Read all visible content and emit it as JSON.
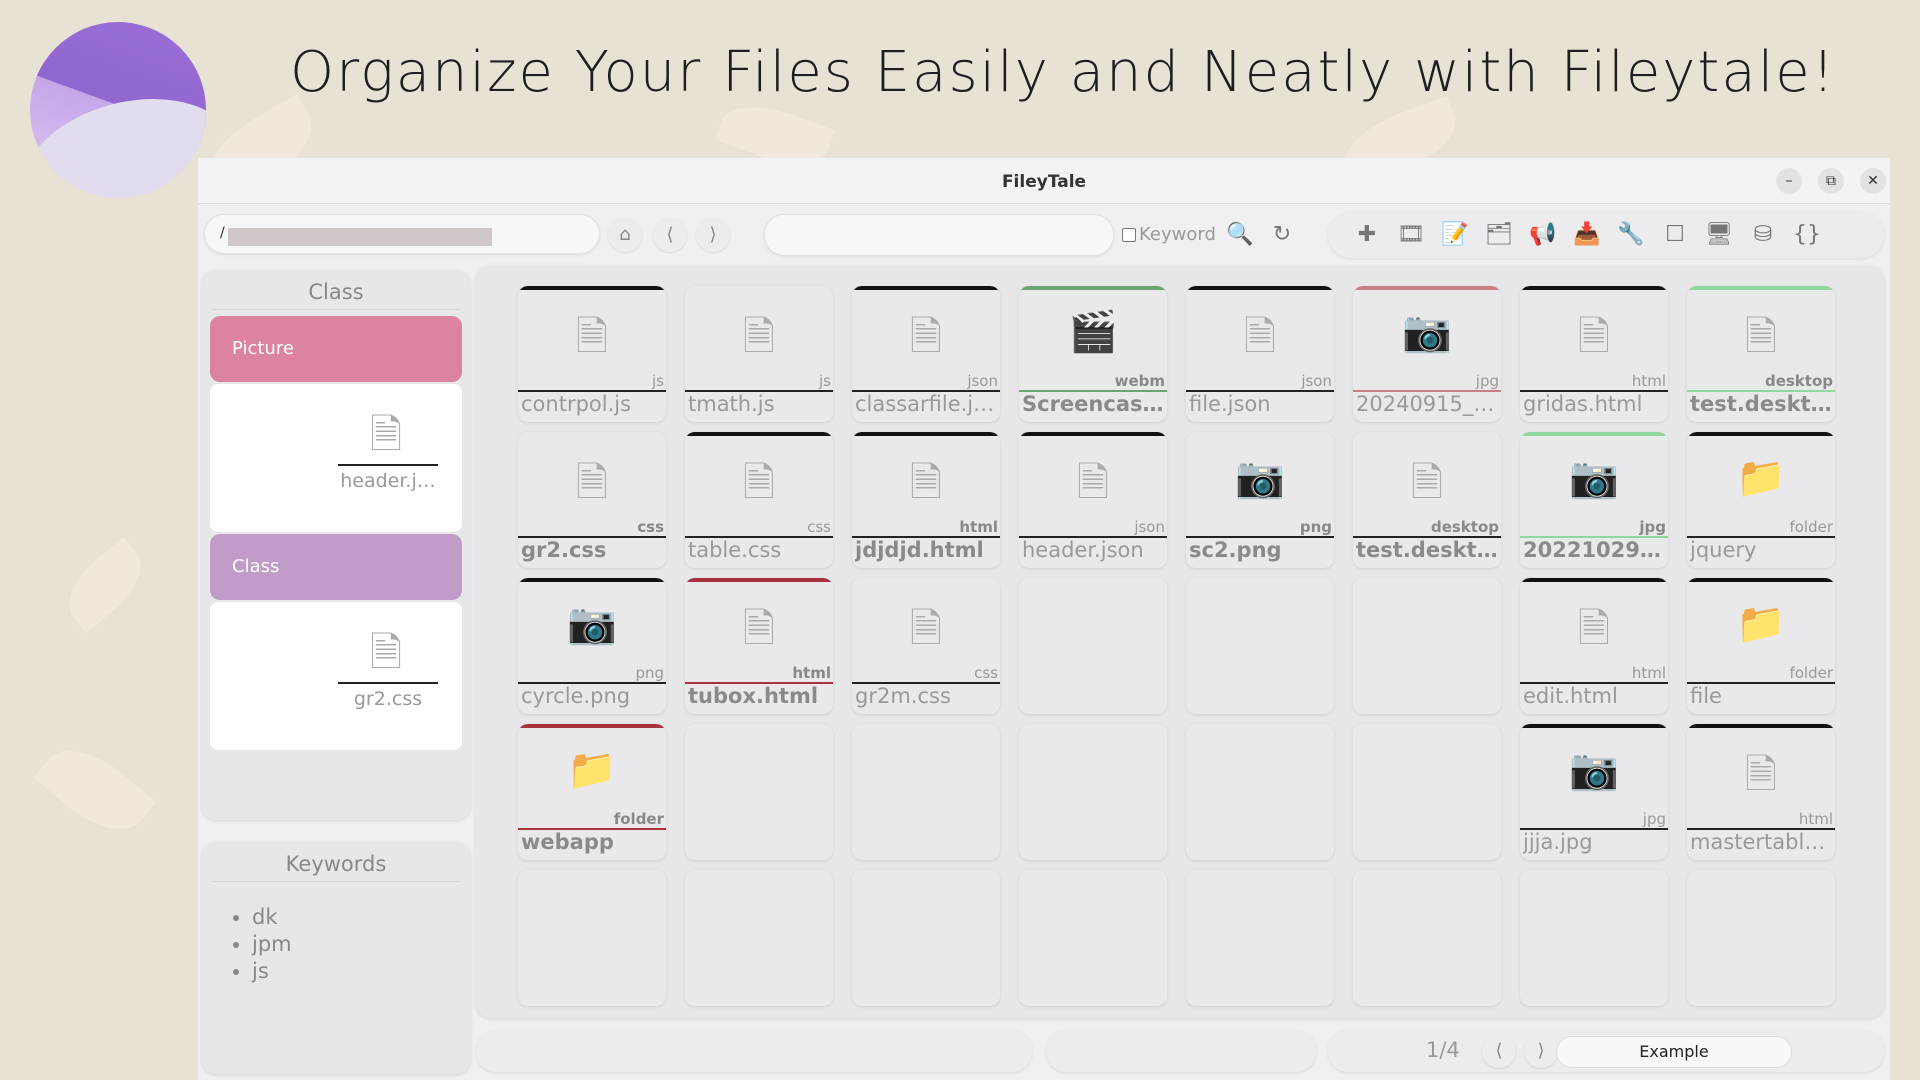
{
  "headline": "Organize Your Files Easily and Neatly with Fileytale!",
  "window": {
    "title": "FileyTale",
    "controls": {
      "minimize": "–",
      "restore": "⧉",
      "close": "✕"
    }
  },
  "toolbar": {
    "path_prefix": "/",
    "search_placeholder": "",
    "keyword_label": "Keyword",
    "nav": {
      "home": "⌂",
      "back": "⟨",
      "forward": "⟩"
    },
    "search_icon": "🔍",
    "refresh_icon": "↻",
    "tools": [
      "✚",
      "🎞",
      "📝",
      "🗂",
      "📢",
      "📥",
      "🔧",
      "☐",
      "🖥",
      "⛁",
      "{}"
    ]
  },
  "sidebar": {
    "class_title": "Class",
    "groups": [
      {
        "label": "Picture",
        "color": "#dc839f",
        "file": "header.j…"
      },
      {
        "label": "Class",
        "color": "#c29cc8",
        "file": "gr2.css"
      }
    ],
    "keywords_title": "Keywords",
    "keywords": [
      "dk",
      "jpm",
      "js"
    ]
  },
  "grid": {
    "tiles": [
      {
        "name": "contrpol.js",
        "ext": "js",
        "icon": "doc",
        "top": "#111",
        "bold": false
      },
      {
        "name": "tmath.js",
        "ext": "js",
        "icon": "doc",
        "top": "",
        "bold": false
      },
      {
        "name": "classarfile.j…",
        "ext": "json",
        "icon": "doc",
        "top": "#111",
        "bold": false
      },
      {
        "name": "Screencast…",
        "ext": "webm",
        "icon": "video",
        "top": "#6aa56e",
        "bold": true
      },
      {
        "name": "file.json",
        "ext": "json",
        "icon": "doc",
        "top": "#111",
        "bold": false
      },
      {
        "name": "20240915_…",
        "ext": "jpg",
        "icon": "camera",
        "top": "#c97f87",
        "bold": false
      },
      {
        "name": "gridas.html",
        "ext": "html",
        "icon": "doc",
        "top": "#111",
        "bold": false
      },
      {
        "name": "test.desktop",
        "ext": "desktop",
        "icon": "doc",
        "top": "#8fd79c",
        "bold": true
      },
      {
        "name": "gr2.css",
        "ext": "css",
        "icon": "doc",
        "top": "",
        "bold": true
      },
      {
        "name": "table.css",
        "ext": "css",
        "icon": "doc",
        "top": "#111",
        "bold": false
      },
      {
        "name": "jdjdjd.html",
        "ext": "html",
        "icon": "doc",
        "top": "#111",
        "bold": true
      },
      {
        "name": "header.json",
        "ext": "json",
        "icon": "doc",
        "top": "#111",
        "bold": false
      },
      {
        "name": "sc2.png",
        "ext": "png",
        "icon": "camera",
        "top": "",
        "bold": true
      },
      {
        "name": "test.desktop",
        "ext": "desktop",
        "icon": "doc",
        "top": "",
        "bold": true
      },
      {
        "name": "20221029_…",
        "ext": "jpg",
        "icon": "camera",
        "top": "#8fd79c",
        "bold": true
      },
      {
        "name": "jquery",
        "ext": "folder",
        "icon": "folder",
        "top": "#111",
        "bold": false
      },
      {
        "name": "cyrcle.png",
        "ext": "png",
        "icon": "camera",
        "top": "#111",
        "bold": false
      },
      {
        "name": "tubox.html",
        "ext": "html",
        "icon": "doc",
        "top": "#a8323c",
        "bold": true
      },
      {
        "name": "gr2m.css",
        "ext": "css",
        "icon": "doc",
        "top": "",
        "bold": false
      },
      null,
      null,
      null,
      {
        "name": "edit.html",
        "ext": "html",
        "icon": "doc",
        "top": "#111",
        "bold": false
      },
      {
        "name": "file",
        "ext": "folder",
        "icon": "folder",
        "top": "#111",
        "bold": false
      },
      {
        "name": "webapp",
        "ext": "folder",
        "icon": "folder",
        "top": "#a8323c",
        "bold": true
      },
      null,
      null,
      null,
      null,
      null,
      {
        "name": "jjja.jpg",
        "ext": "jpg",
        "icon": "camera",
        "top": "#111",
        "bold": false
      },
      {
        "name": "mastertable…",
        "ext": "html",
        "icon": "doc",
        "top": "#111",
        "bold": false
      },
      null,
      null,
      null,
      null,
      null,
      null,
      null,
      null
    ]
  },
  "bottom": {
    "page": "1/4",
    "prev": "⟨",
    "next": "⟩",
    "example_label": "Example"
  }
}
